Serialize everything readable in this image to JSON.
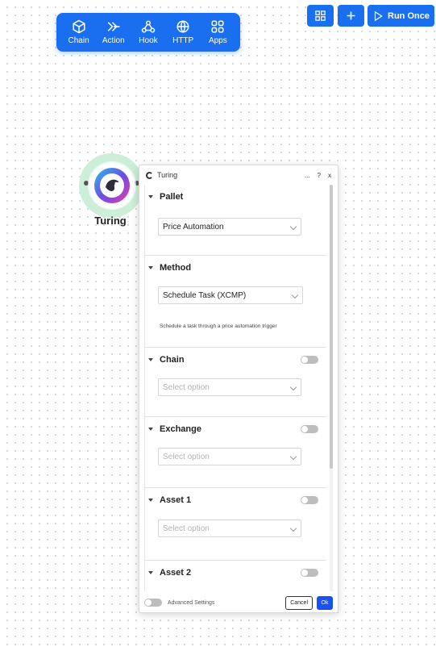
{
  "toolbar": {
    "items": [
      {
        "label": "Chain",
        "icon": "cube-icon"
      },
      {
        "label": "Action",
        "icon": "action-arrow-icon"
      },
      {
        "label": "Hook",
        "icon": "webhook-icon"
      },
      {
        "label": "HTTP",
        "icon": "globe-icon"
      },
      {
        "label": "Apps",
        "icon": "apps-grid-icon"
      }
    ]
  },
  "top_buttons": {
    "run_label": "Run Once"
  },
  "node": {
    "title": "Turing"
  },
  "panel": {
    "title": "Turing",
    "controls": {
      "more": "...",
      "help": "?",
      "close": "x"
    },
    "sections": {
      "pallet": {
        "title": "Pallet",
        "value": "Price Automation"
      },
      "method": {
        "title": "Method",
        "value": "Schedule Task (XCMP)",
        "description": "Schedule a task through a price automation trigger"
      },
      "chain": {
        "title": "Chain",
        "placeholder": "Select option"
      },
      "exchange": {
        "title": "Exchange",
        "placeholder": "Select option"
      },
      "asset1": {
        "title": "Asset 1",
        "placeholder": "Select option"
      },
      "asset2": {
        "title": "Asset 2"
      }
    },
    "footer": {
      "advanced_label": "Advanced Settings",
      "cancel_label": "Cancel",
      "ok_label": "Ok"
    }
  },
  "colors": {
    "accent": "#1a6ff0",
    "ok_button": "#1a4ff0",
    "node_halo": "#cdeed9"
  }
}
